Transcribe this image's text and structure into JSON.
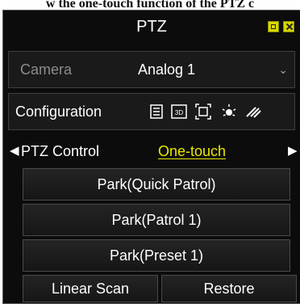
{
  "caption": "w the one-touch function of the PTZ c",
  "window": {
    "title": "PTZ"
  },
  "camera": {
    "label": "Camera",
    "value": "Analog 1"
  },
  "configuration": {
    "label": "Configuration",
    "tools": [
      "list-icon",
      "3d-icon",
      "focus-frame-icon",
      "light-icon",
      "wiper-icon"
    ],
    "tool_3d_text": "3D"
  },
  "tabs": [
    {
      "label": "PTZ Control",
      "active": false
    },
    {
      "label": "One-touch",
      "active": true
    }
  ],
  "actions": [
    "Park(Quick Patrol)",
    "Park(Patrol 1)",
    "Park(Preset 1)"
  ],
  "bottom_buttons": {
    "linear_scan": "Linear Scan",
    "restore": "Restore"
  },
  "colors": {
    "accent": "#e8e800",
    "panel": "#0c0c0c",
    "muted_label": "#8c8c8c"
  }
}
